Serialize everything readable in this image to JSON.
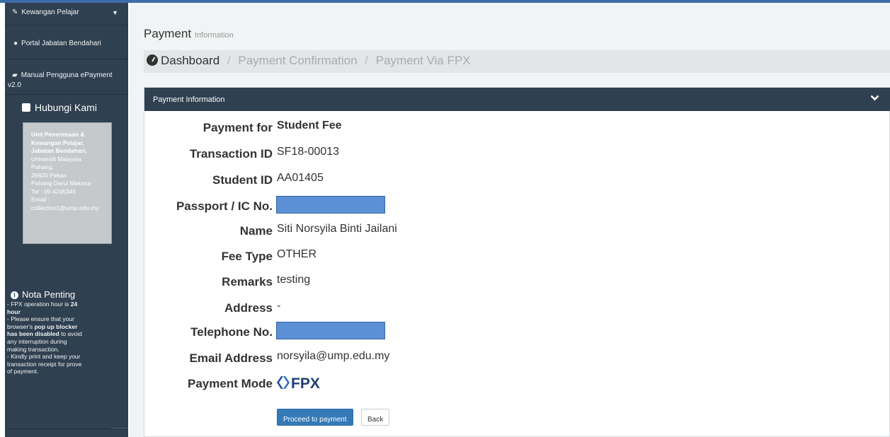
{
  "sidebar": {
    "kewangan_label": "Kewangan Pelajar",
    "portal_label": "Portal Jabatan Bendahari",
    "manual_label_line1": "Manual Pengguna ePayment",
    "manual_label_line2": "v2.0",
    "hubungi_title": "Hubungi Kami",
    "contact": {
      "line1": "Unit Penerimaan &",
      "line2": "Kewangan Pelajar,",
      "line3": "Jabatan Bendahari,",
      "line4": "Universiti Malaysia",
      "line5": "Pahang,",
      "line6": "26600 Pekan",
      "line7": "Pahang Darul Makmur",
      "line8": "Tel : 09-4245345",
      "line9": "Email :",
      "line10": "collection1@ump.edu.my"
    },
    "nota": {
      "title": "Nota Penting",
      "l1a": "- FPX operation hour is ",
      "l1b": "24",
      "l1c": "hour",
      "l2a": "- Please ensure that your",
      "l2b": "browser's ",
      "l2c": "pop up blocker",
      "l2d": "has been disabled",
      "l2e": " to avoid",
      "l2f": "any interruption during",
      "l2g": "making transaction.",
      "l3a": "- Kindly print and keep your",
      "l3b": "transaction receipt for prove",
      "l3c": "of payment."
    }
  },
  "header": {
    "title": "Payment",
    "subtitle": "Information"
  },
  "breadcrumb": {
    "items": [
      "Dashboard",
      "Payment Confirmation",
      "Payment Via FPX"
    ],
    "sep": "/"
  },
  "panel": {
    "title": "Payment Information",
    "fields": {
      "payment_for": {
        "label": "Payment for",
        "value": "Student Fee"
      },
      "transaction_id": {
        "label": "Transaction ID",
        "value": "SF18-00013"
      },
      "student_id": {
        "label": "Student ID",
        "value": "AA01405"
      },
      "passport": {
        "label": "Passport / IC No."
      },
      "name": {
        "label": "Name",
        "value": "Siti Norsyila Binti Jailani"
      },
      "fee_type": {
        "label": "Fee Type",
        "value": "OTHER"
      },
      "remarks": {
        "label": "Remarks",
        "value": "testing"
      },
      "address": {
        "label": "Address",
        "value": "-"
      },
      "telephone": {
        "label": "Telephone No."
      },
      "email": {
        "label": "Email Address",
        "value": "norsyila@ump.edu.my"
      },
      "payment_mode": {
        "label": "Payment Mode",
        "logo_text": "FPX"
      }
    },
    "buttons": {
      "proceed": "Proceed to payment",
      "back": "Back"
    }
  },
  "colors": {
    "sidebar_bg": "#2f4050",
    "primary_button": "#337ab7",
    "fpx_blue": "#1e4e8c",
    "redaction": "#5b8fd6"
  }
}
